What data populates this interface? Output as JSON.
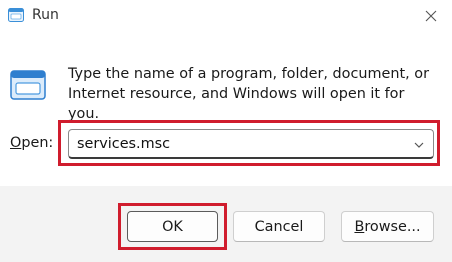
{
  "window": {
    "title": "Run",
    "close_icon": "close-icon",
    "app_icon": "run-icon"
  },
  "dialog": {
    "description": "Type the name of a program, folder, document, or Internet resource, and Windows will open it for you.",
    "open_label_underlined": "O",
    "open_label_rest": "pen:",
    "open_value": "services.msc"
  },
  "buttons": {
    "ok": "OK",
    "cancel": "Cancel",
    "browse_underlined": "B",
    "browse_rest": "rowse..."
  },
  "colors": {
    "highlight": "#d01c2d",
    "run_icon_blue": "#3a8fd8",
    "footer_bg": "#f3f3f3"
  }
}
